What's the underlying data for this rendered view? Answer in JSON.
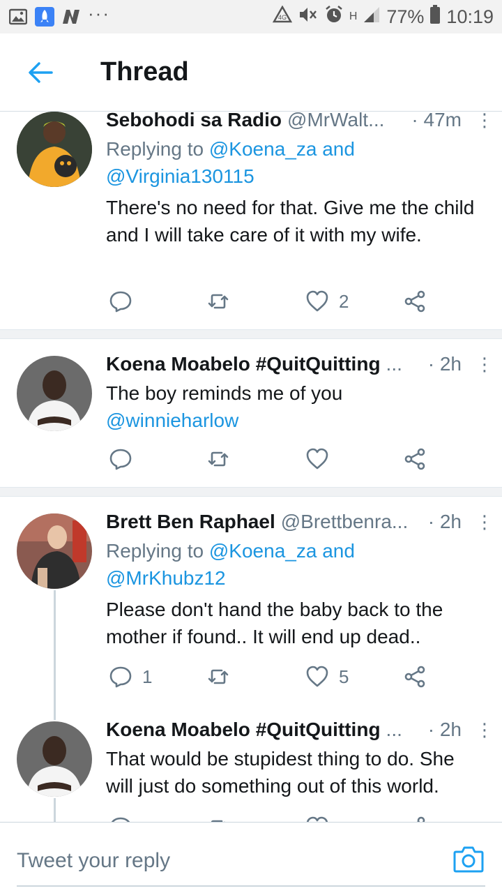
{
  "status_bar": {
    "battery": "77%",
    "time": "10:19",
    "network": "H"
  },
  "header": {
    "title": "Thread"
  },
  "tweets": [
    {
      "name": "Sebohodi sa Radio",
      "handle": "@MrWalt...",
      "time": "· 47m",
      "replying_prefix": "Replying to ",
      "replying_to_1": "@Koena_za",
      "replying_and": " and",
      "replying_to_2": "@Virginia130115",
      "text": "There's no need for that. Give me the child and I will take care of it with my wife.",
      "reply_count": "",
      "retweet_count": "",
      "like_count": "2"
    },
    {
      "name": "Koena Moabelo #QuitQuitting",
      "handle": "...",
      "time": "· 2h",
      "text": "The boy reminds me of you",
      "text_link": "@winnieharlow",
      "reply_count": "",
      "retweet_count": "",
      "like_count": ""
    },
    {
      "name": "Brett Ben Raphael",
      "handle": "@Brettbenra...",
      "time": "· 2h",
      "replying_prefix": "Replying to ",
      "replying_to_1": "@Koena_za",
      "replying_and": " and",
      "replying_to_2": "@MrKhubz12",
      "text": "Please don't hand the baby back to the mother if found.. It will end up dead..",
      "reply_count": "1",
      "retweet_count": "",
      "like_count": "5"
    },
    {
      "name": "Koena Moabelo #QuitQuitting",
      "handle": "...",
      "time": "· 2h",
      "text": "That would be stupidest thing to do. She will just do something out of this world.",
      "reply_count": "",
      "retweet_count": "",
      "like_count": ""
    }
  ],
  "reply_bar": {
    "placeholder": "Tweet your reply"
  },
  "colors": {
    "link": "#1b95e0",
    "muted": "#657786",
    "separator": "#f0f2f4"
  }
}
